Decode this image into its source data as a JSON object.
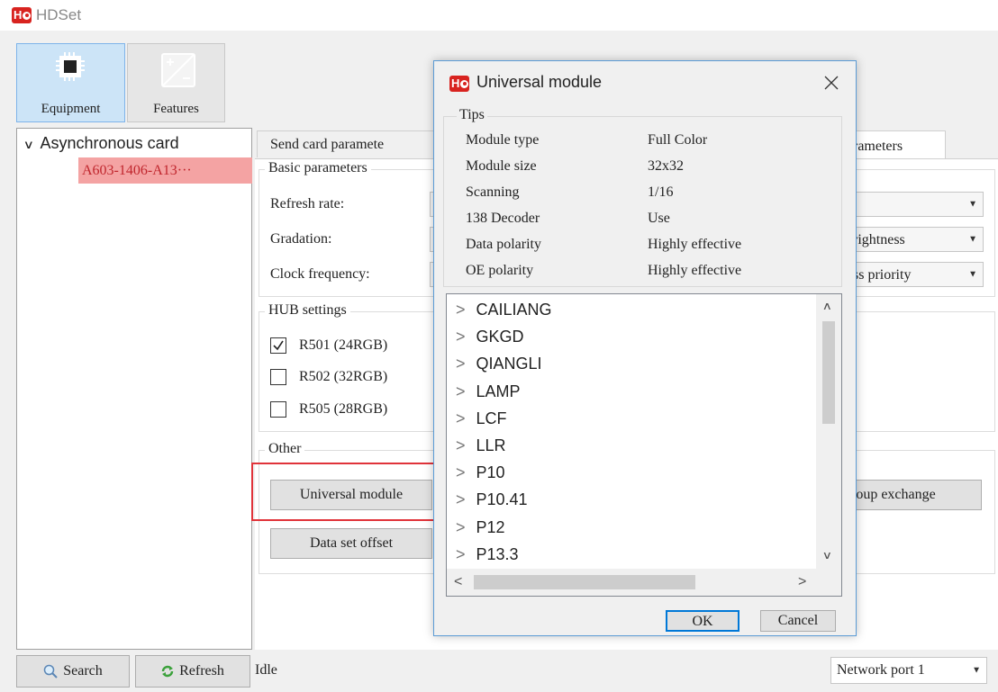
{
  "app": {
    "title": "HDSet",
    "logo_letter": "H"
  },
  "toolbar": {
    "equipment_label": "Equipment",
    "features_label": "Features"
  },
  "tree": {
    "root_label": "Asynchronous card",
    "child_label": "A603-1406-A13···"
  },
  "tabs": {
    "send_card": "Send card paramete",
    "screen_params": "rameters"
  },
  "basic": {
    "legend": "Basic parameters",
    "refresh_label": "Refresh rate:",
    "gradation_label": "Gradation:",
    "clock_label": "Clock frequency:",
    "right_combo_1": "",
    "right_combo_2": "rightness",
    "right_combo_3": "ss priority"
  },
  "hub": {
    "legend": "HUB settings",
    "items": [
      {
        "label": "R501 (24RGB)",
        "checked": true
      },
      {
        "label": "R502 (32RGB)",
        "checked": false
      },
      {
        "label": "R505 (28RGB)",
        "checked": false
      }
    ]
  },
  "other": {
    "legend": "Other",
    "universal_module_btn": "Universal module",
    "data_set_offset_btn": "Data set offset",
    "group_exchange_btn": "roup exchange"
  },
  "bottom": {
    "search_btn": "Search",
    "refresh_btn": "Refresh",
    "status": "Idle",
    "network_port": "Network port 1"
  },
  "dialog": {
    "title": "Universal module",
    "tips_legend": "Tips",
    "tips": [
      {
        "key": "Module type",
        "value": "Full Color"
      },
      {
        "key": "Module size",
        "value": "32x32"
      },
      {
        "key": "Scanning",
        "value": "1/16"
      },
      {
        "key": "138 Decoder",
        "value": "Use"
      },
      {
        "key": "Data polarity",
        "value": "Highly effective"
      },
      {
        "key": "OE polarity",
        "value": "Highly effective"
      }
    ],
    "list": [
      "CAILIANG",
      "GKGD",
      "QIANGLI",
      "LAMP",
      "LCF",
      "LLR",
      "P10",
      "P10.41",
      "P12",
      "P13.3"
    ],
    "ok_btn": "OK",
    "cancel_btn": "Cancel"
  },
  "colors": {
    "accent": "#0078d7",
    "selected_tree": "#f4a3a3",
    "highlight_box": "#e0333a",
    "logo": "#d8231f"
  }
}
